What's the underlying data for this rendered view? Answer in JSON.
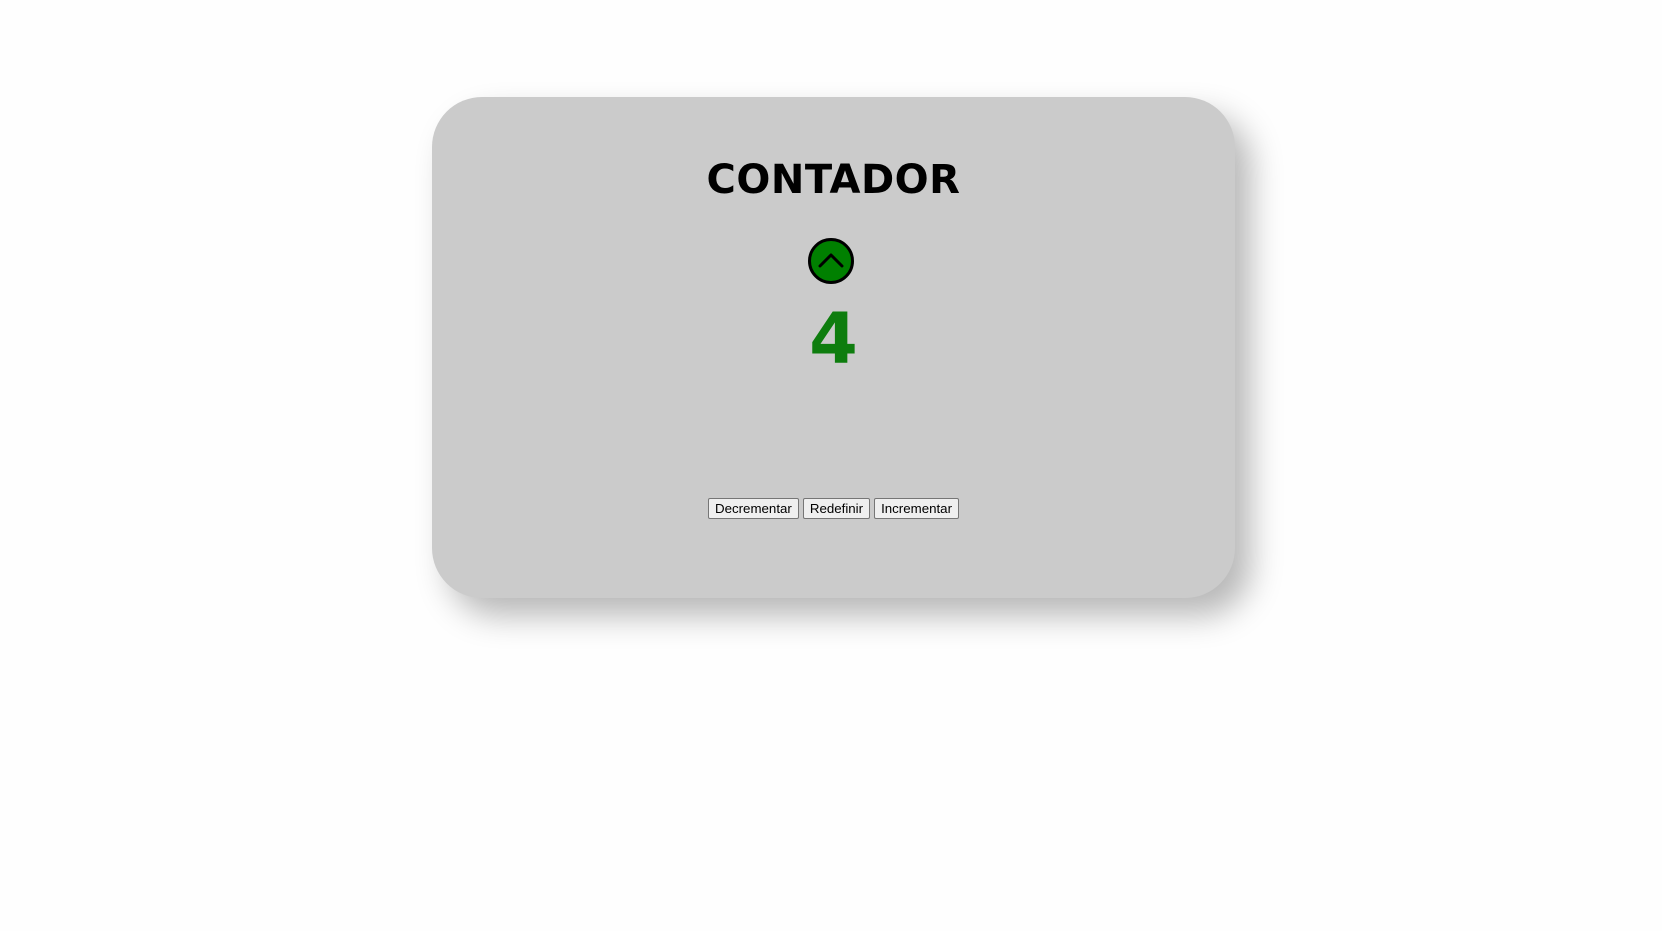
{
  "counter": {
    "title": "CONTADOR",
    "value": "4",
    "direction_icon": "chevron-up-icon",
    "value_color": "#0e7d0e",
    "indicator_color": "#008000"
  },
  "buttons": {
    "decrement_label": "Decrementar",
    "reset_label": "Redefinir",
    "increment_label": "Incrementar"
  },
  "colors": {
    "card_background": "#cbcbcb",
    "page_background": "#fefefe"
  }
}
